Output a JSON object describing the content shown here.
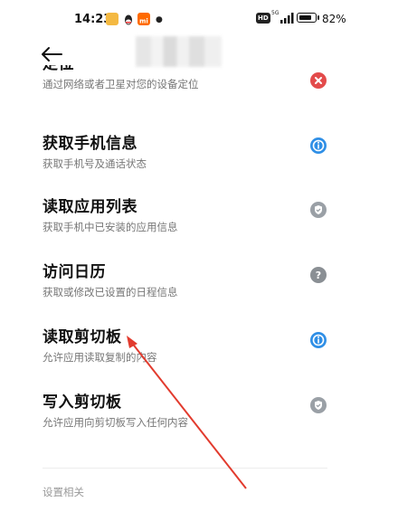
{
  "status_bar": {
    "time": "14:23",
    "network": "5G",
    "hd": "HD",
    "battery_percent_text": "82%",
    "battery_level": 0.82,
    "app_icons": [
      "notification-app-icon",
      "qq-icon",
      "mi-app-icon"
    ]
  },
  "header": {
    "back_icon": "arrow-left-icon",
    "title_blurred": true
  },
  "permissions": [
    {
      "title": "定位",
      "desc": "通过网络或者卫星对您的设备定位",
      "status_icon": "red-x-icon",
      "status_color": "#e34b4b",
      "partially_visible": true
    },
    {
      "title": "获取手机信息",
      "desc": "获取手机号及通话状态",
      "status_icon": "info-blue-icon",
      "status_color": "#2f8fe6"
    },
    {
      "title": "读取应用列表",
      "desc": "获取手机中已安装的应用信息",
      "status_icon": "shield-check-icon",
      "status_color": "#9aa0a6"
    },
    {
      "title": "访问日历",
      "desc": "获取或修改已设置的日程信息",
      "status_icon": "question-icon",
      "status_color": "#8a8f94"
    },
    {
      "title": "读取剪切板",
      "desc": "允许应用读取复制的内容",
      "status_icon": "info-blue-icon",
      "status_color": "#2f8fe6"
    },
    {
      "title": "写入剪切板",
      "desc": "允许应用向剪切板写入任何内容",
      "status_icon": "shield-check-icon",
      "status_color": "#9aa0a6"
    }
  ],
  "section_label": "设置相关",
  "annotation": {
    "color": "#e23b2e",
    "arrow_icon": "red-annotation-arrow"
  }
}
